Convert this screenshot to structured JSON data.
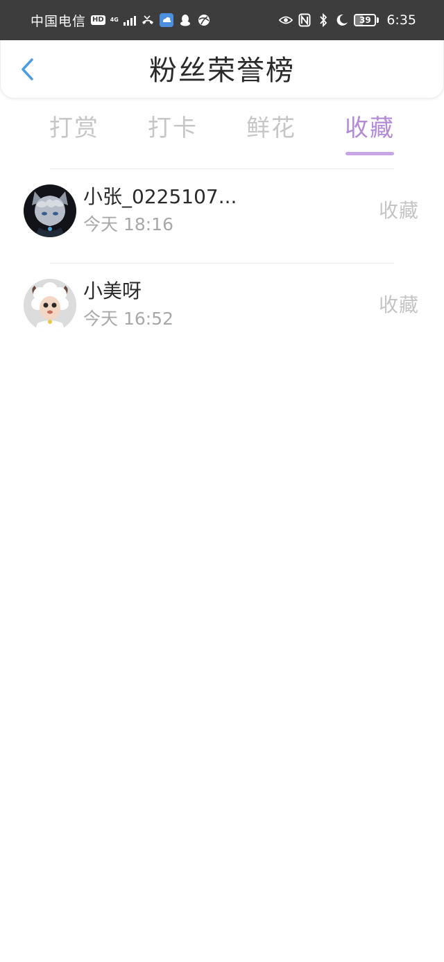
{
  "status_bar": {
    "carrier": "中国电信",
    "hd": "HD",
    "network": "4G",
    "battery": "39",
    "battery_level": 0.39,
    "time": "6:35",
    "icons": [
      "signal-icon",
      "missed-call-icon",
      "app-notification-icon",
      "qq-icon",
      "ball-icon",
      "eye-icon",
      "nfc-icon",
      "bluetooth-icon",
      "moon-icon"
    ]
  },
  "header": {
    "title": "粉丝荣誉榜"
  },
  "tabs": [
    {
      "label": "打赏",
      "active": false
    },
    {
      "label": "打卡",
      "active": false
    },
    {
      "label": "鲜花",
      "active": false
    },
    {
      "label": "收藏",
      "active": true
    }
  ],
  "list": [
    {
      "name": "小张_0225107...",
      "time": "今天 18:16",
      "action": "收藏",
      "avatar": "wolf-character-avatar"
    },
    {
      "name": "小美呀",
      "time": "今天 16:52",
      "action": "收藏",
      "avatar": "sheep-character-avatar"
    }
  ],
  "colors": {
    "status_bar_bg": "#3d3d3d",
    "accent": "#b38ad6",
    "back_icon": "#4a9de0",
    "inactive_tab": "#c6c6c6"
  }
}
